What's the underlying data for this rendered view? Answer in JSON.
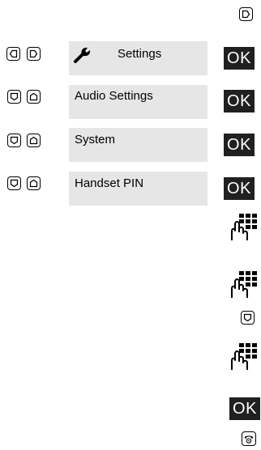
{
  "menu": {
    "settings": "Settings",
    "audio_settings": "Audio Settings",
    "system": "System",
    "handset_pin": "Handset PIN"
  },
  "ok_label": "OK",
  "icons": {
    "nav_right": "right-nav-key-icon",
    "nav_left": "left-nav-key-icon",
    "nav_down": "down-nav-key-icon",
    "nav_up": "up-nav-key-icon",
    "wrench": "wrench-icon",
    "keypad": "keypad-icon",
    "end_call": "end-call-key-icon"
  }
}
